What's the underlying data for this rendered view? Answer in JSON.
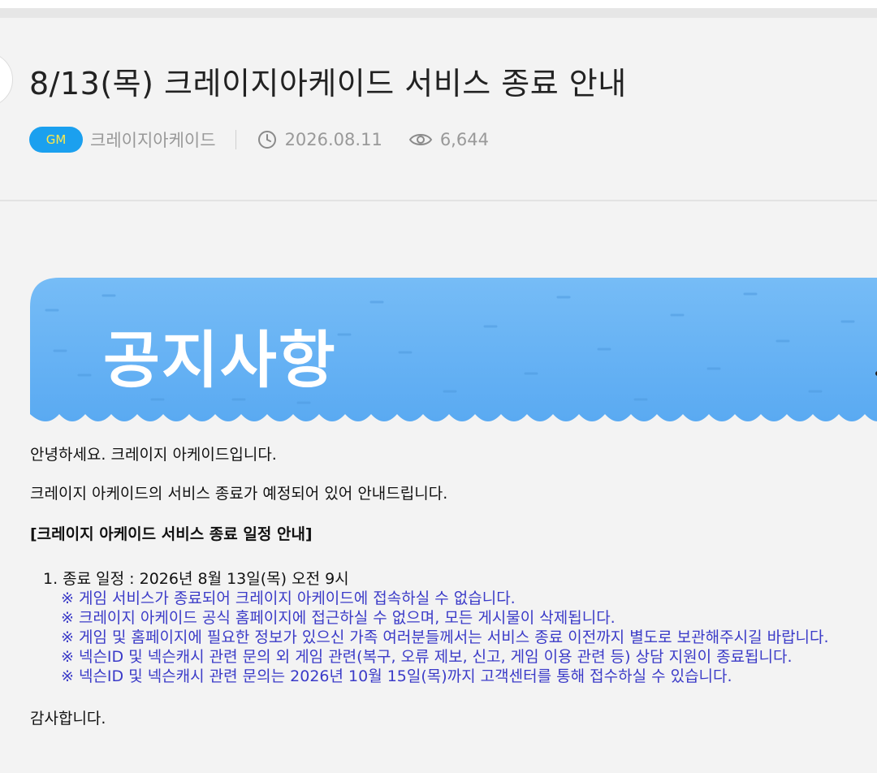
{
  "post": {
    "title": "8/13(목) 크레이지아케이드 서비스 종료 안내",
    "badge": "GM",
    "author": "크레이지아케이드",
    "date": "2026.08.11",
    "views": "6,644"
  },
  "banner": {
    "text": "공지사항"
  },
  "body": {
    "greeting": "안녕하세요. 크레이지 아케이드입니다.",
    "intro": "크레이지 아케이드의 서비스 종료가 예정되어 있어 안내드립니다.",
    "heading": "[크레이지 아케이드 서비스 종료 일정 안내]",
    "schedule": "1. 종료 일정 : 2026년 8월 13일(목) 오전 9시",
    "notes": [
      "※ 게임 서비스가 종료되어 크레이지 아케이드에 접속하실 수 없습니다.",
      "※ 크레이지 아케이드 공식 홈페이지에 접근하실 수 없으며, 모든 게시물이 삭제됩니다.",
      "※ 게임 및 홈페이지에 필요한 정보가 있으신 가족 여러분들께서는 서비스 종료 이전까지 별도로 보관해주시길 바랍니다.",
      "※ 넥슨ID 및 넥슨캐시 관련 문의 외 게임 관련(복구, 오류 제보, 신고, 게임 이용 관련 등) 상담 지원이 종료됩니다.",
      "※ 넥슨ID 및 넥슨캐시 관련 문의는 2026년 10월 15일(목)까지 고객센터를 통해 접수하실 수 있습니다."
    ],
    "closing": "감사합니다."
  },
  "colors": {
    "badge_bg": "#1ba0ef",
    "badge_text": "#ffe94a",
    "banner_blue": "#69b6f6",
    "note_text": "#3b3bc8"
  },
  "icons": {
    "clock": "clock-icon",
    "views": "eye-icon",
    "back": "back-button"
  }
}
